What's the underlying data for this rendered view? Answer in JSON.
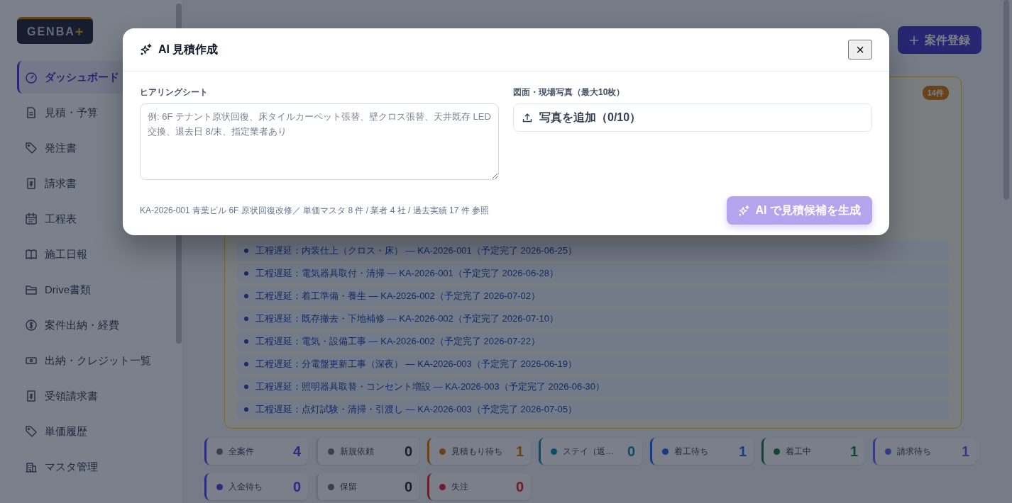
{
  "sidebar": {
    "logo": {
      "text": "GENBA",
      "mark": "+"
    },
    "items": [
      {
        "label": "ダッシュボード",
        "selected": true
      },
      {
        "label": "見積・予算",
        "selected": false
      },
      {
        "label": "発注書",
        "selected": false
      },
      {
        "label": "請求書",
        "selected": false
      },
      {
        "label": "工程表",
        "selected": false
      },
      {
        "label": "施工日報",
        "selected": false
      },
      {
        "label": "Drive書類",
        "selected": false
      },
      {
        "label": "案件出納・経費",
        "selected": false
      },
      {
        "label": "出納・クレジット一覧",
        "selected": false
      },
      {
        "label": "受領請求書",
        "selected": false
      },
      {
        "label": "単価履歴",
        "selected": false
      },
      {
        "label": "マスタ管理",
        "selected": false
      }
    ]
  },
  "header": {
    "new_button": "案件登録"
  },
  "alerts": {
    "count": "14件",
    "items": [
      "工程遅延：内装仕上（クロス・床） — KA-2026-001（予定完了 2026-06-25）",
      "工程遅延：電気器具取付・清掃 — KA-2026-001（予定完了 2026-06-28）",
      "工程遅延：着工準備・養生 — KA-2026-002（予定完了 2026-07-02）",
      "工程遅延：既存撤去・下地補修 — KA-2026-002（予定完了 2026-07-10）",
      "工程遅延：電気・設備工事 — KA-2026-002（予定完了 2026-07-22）",
      "工程遅延：分電盤更新工事（深夜） — KA-2026-003（予定完了 2026-06-19）",
      "工程遅延：照明器具取替・コンセント増設 — KA-2026-003（予定完了 2026-06-30）",
      "工程遅延：点灯試験・清掃・引渡し — KA-2026-003（予定完了 2026-07-05）"
    ]
  },
  "status_cards": [
    {
      "kind": "total",
      "label": "全案件",
      "count": "4",
      "color": "#384051"
    },
    {
      "kind": "neutral",
      "label": "新規依頼",
      "count": "0",
      "color": "#384051"
    },
    {
      "kind": "status",
      "label": "見積もり待ち",
      "count": "1",
      "color": "#6a421a"
    },
    {
      "kind": "status",
      "label": "ステイ（返…",
      "count": "0",
      "color": "#0c4e67"
    },
    {
      "kind": "status",
      "label": "着工待ち",
      "count": "1",
      "color": "#193981"
    },
    {
      "kind": "status",
      "label": "着工中",
      "count": "1",
      "color": "#124633"
    },
    {
      "kind": "status",
      "label": "請求待ち",
      "count": "1",
      "color": "#353b84"
    },
    {
      "kind": "status",
      "label": "入金待ち",
      "count": "0",
      "color": "#2c2c7e"
    },
    {
      "kind": "neutral",
      "label": "保留",
      "count": "0",
      "color": "#384051"
    },
    {
      "kind": "status",
      "label": "失注",
      "count": "0",
      "color": "#6b1e28"
    }
  ],
  "modal": {
    "title": "AI 見積作成",
    "close": "×",
    "hearing": {
      "label": "ヒアリングシート",
      "placeholder": "例: 6F テナント原状回復、床タイルカーペット張替、壁クロス張替、天井既存 LED 交換、退去日 8/末、指定業者あり"
    },
    "photos": {
      "label": "図面・現場写真（最大10枚）",
      "button": "写真を追加（0/10）"
    },
    "note": "KA-2026-001 青葉ビル 6F 原状回復改修／ 単価マスタ 8 件 / 業者 4 社 / 過去実績 17 件 参照",
    "generate": {
      "label": "AI で見積候補を生成",
      "disabled": true
    }
  }
}
